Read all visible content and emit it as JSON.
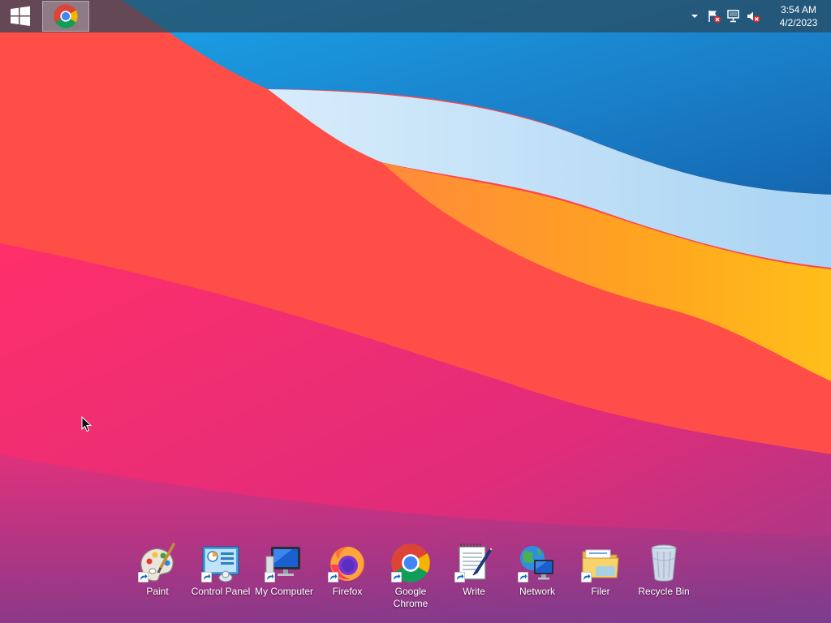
{
  "taskbar": {
    "start_icon": "windows-logo-icon",
    "pinned_app": "chrome-icon",
    "tray": {
      "icons": [
        "chevron-up-icon",
        "action-center-flag-icon",
        "network-icon",
        "volume-muted-icon"
      ],
      "time": "3:54 AM",
      "date": "4/2/2023"
    }
  },
  "desktop": {
    "icons": [
      {
        "label": "Paint",
        "icon": "paint-palette-icon"
      },
      {
        "label": "Control Panel",
        "icon": "control-panel-icon"
      },
      {
        "label": "My Computer",
        "icon": "computer-icon"
      },
      {
        "label": "Firefox",
        "icon": "firefox-icon"
      },
      {
        "label": "Google Chrome",
        "icon": "chrome-icon"
      },
      {
        "label": "Write",
        "icon": "notepad-pen-icon"
      },
      {
        "label": "Network",
        "icon": "network-globe-icon"
      },
      {
        "label": "Filer",
        "icon": "folder-icon"
      },
      {
        "label": "Recycle Bin",
        "icon": "recycle-bin-icon"
      }
    ]
  },
  "colors": {
    "taskbar": "#2b4a5c",
    "wallpaper_red": "#ff3d55",
    "wallpaper_blue": "#1e88d6",
    "wallpaper_orange": "#ffa21f",
    "wallpaper_magenta": "#c2307a"
  }
}
